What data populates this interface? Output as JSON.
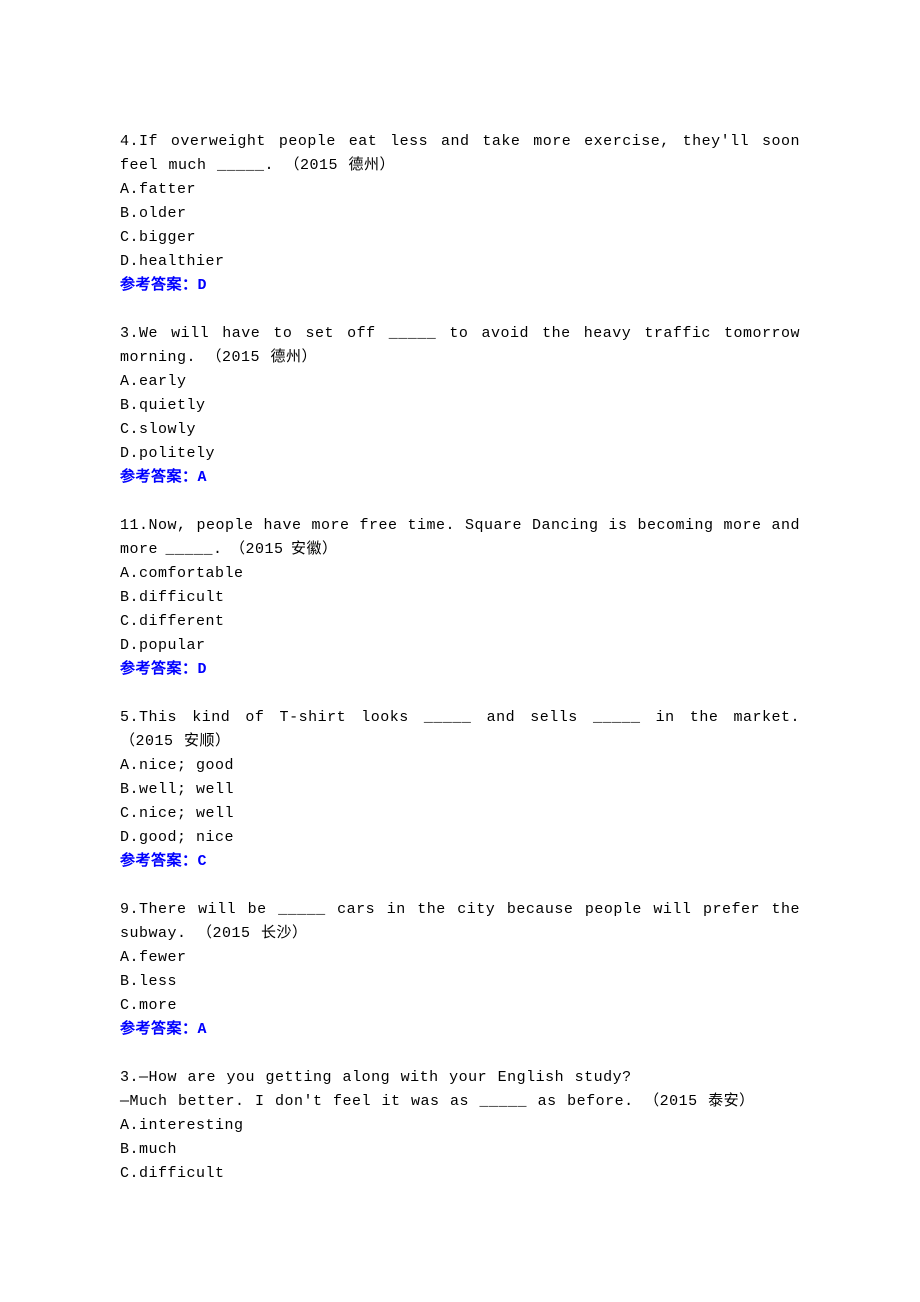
{
  "questions": [
    {
      "number": "4",
      "stem": "If overweight people eat less and take more exercise, they'll soon feel much _____.",
      "source": "（2015 德州）",
      "stem_line2": "",
      "options": [
        "A.fatter",
        "B.older",
        "C.bigger",
        "D.healthier"
      ],
      "answer_label": "参考答案：",
      "answer": "D"
    },
    {
      "number": "3",
      "stem": "We will have to set off _____ to avoid the heavy traffic tomorrow morning. （2015 德州）",
      "source": "",
      "stem_line2": "",
      "options": [
        "A.early",
        "B.quietly",
        "C.slowly",
        "D.politely"
      ],
      "answer_label": "参考答案：",
      "answer": "A"
    },
    {
      "number": "11",
      "stem": "Now, people have more free time. Square Dancing is becoming more and more _____. （2015 安徽）",
      "source": "",
      "stem_line2": "",
      "options": [
        "A.comfortable",
        "B.difficult",
        "C.different",
        "D.popular"
      ],
      "answer_label": "参考答案：",
      "answer": "D"
    },
    {
      "number": "5",
      "stem": "This kind of T-shirt looks _____ and sells _____ in the market. （2015 安顺）",
      "source": "",
      "stem_line2": "",
      "options": [
        "A.nice; good",
        "B.well; well",
        "C.nice; well",
        "D.good; nice"
      ],
      "answer_label": "参考答案：",
      "answer": "C"
    },
    {
      "number": "9",
      "stem": "There will be _____ cars in the city because people will prefer the subway. （2015 长沙）",
      "source": "",
      "stem_line2": "",
      "options": [
        "A.fewer",
        "B.less",
        "C.more"
      ],
      "answer_label": "参考答案：",
      "answer": "A"
    },
    {
      "number": "3",
      "stem": "—How are you getting along with your English study?",
      "source": "",
      "stem_line2": "—Much better. I don't feel it was as _____ as before. （2015 泰安）",
      "options": [
        "A.interesting",
        "B.much",
        "C.difficult"
      ],
      "answer_label": "",
      "answer": ""
    }
  ]
}
